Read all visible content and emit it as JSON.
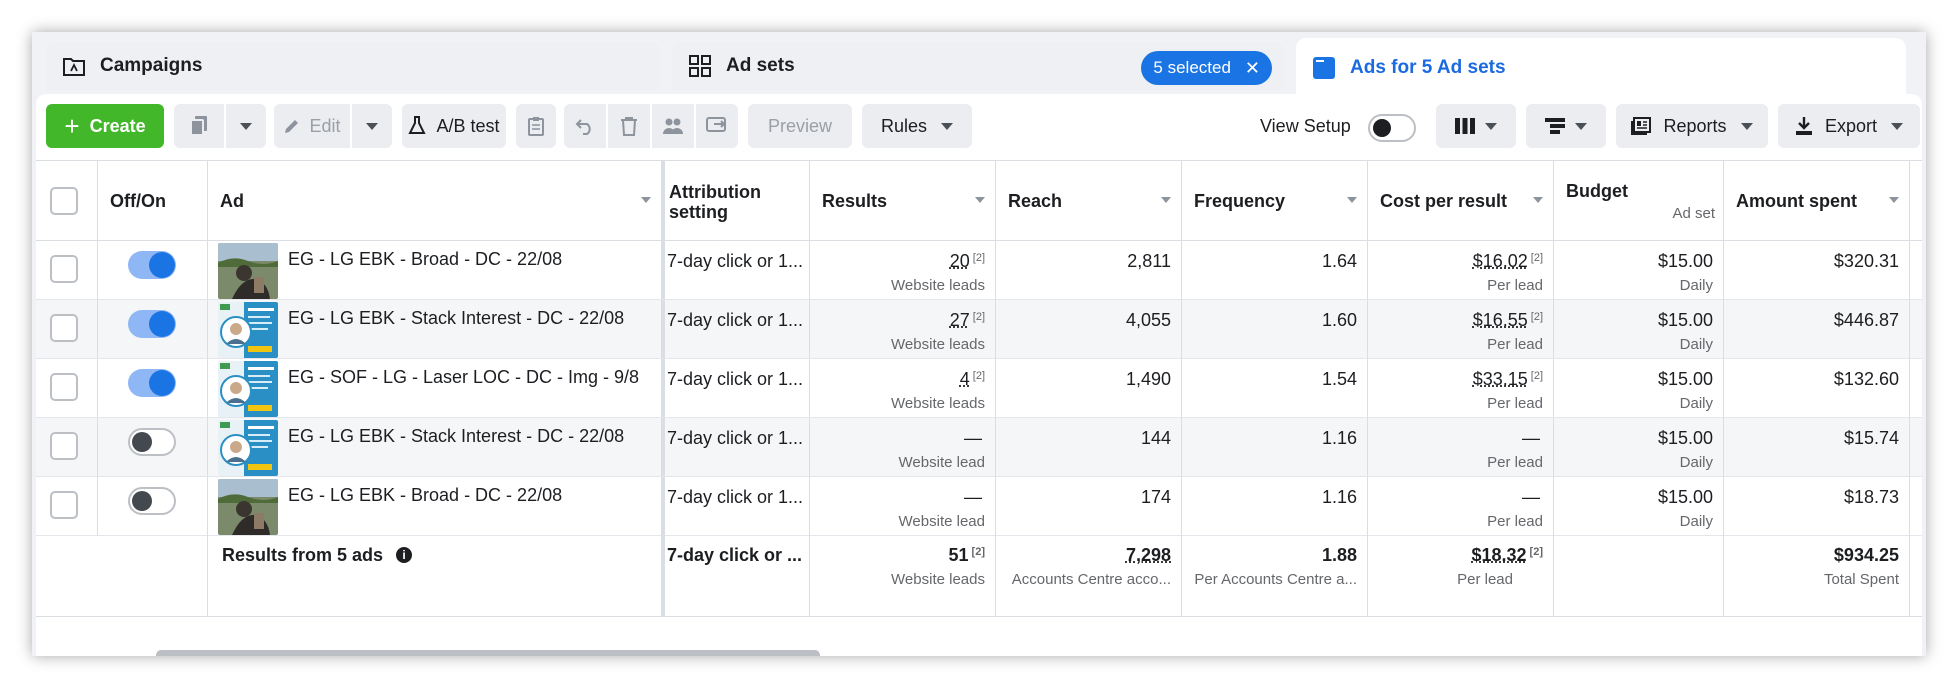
{
  "tabs": {
    "campaigns": "Campaigns",
    "adsets": "Ad sets",
    "adsets_selected": "5 selected",
    "ads": "Ads for 5 Ad sets"
  },
  "toolbar": {
    "create": "Create",
    "edit": "Edit",
    "ab_test": "A/B test",
    "preview": "Preview",
    "rules": "Rules",
    "view_setup": "View Setup",
    "reports": "Reports",
    "export": "Export"
  },
  "columns": {
    "off_on": "Off/On",
    "ad": "Ad",
    "attribution": "Attribution setting",
    "results": "Results",
    "reach": "Reach",
    "frequency": "Frequency",
    "cost_per_result": "Cost per result",
    "budget": "Budget",
    "budget_sub": "Ad set",
    "amount_spent": "Amount spent"
  },
  "rows": [
    {
      "on": true,
      "name": "EG - LG EBK - Broad - DC - 22/08",
      "thumb": "photo",
      "attribution": "7-day click or 1...",
      "results": "20",
      "results_ref": "[2]",
      "results_sub": "Website leads",
      "reach": "2,811",
      "frequency": "1.64",
      "cpr": "$16.02",
      "cpr_ref": "[2]",
      "cpr_sub": "Per lead",
      "budget": "$15.00",
      "budget_sub": "Daily",
      "spent": "$320.31"
    },
    {
      "on": true,
      "name": "EG - LG EBK - Stack Interest - DC - 22/08",
      "thumb": "flyer",
      "attribution": "7-day click or 1...",
      "results": "27",
      "results_ref": "[2]",
      "results_sub": "Website leads",
      "reach": "4,055",
      "frequency": "1.60",
      "cpr": "$16.55",
      "cpr_ref": "[2]",
      "cpr_sub": "Per lead",
      "budget": "$15.00",
      "budget_sub": "Daily",
      "spent": "$446.87"
    },
    {
      "on": true,
      "name": "EG - SOF - LG - Laser LOC - DC - Img - 9/8",
      "thumb": "flyer",
      "attribution": "7-day click or 1...",
      "results": "4",
      "results_ref": "[2]",
      "results_sub": "Website leads",
      "reach": "1,490",
      "frequency": "1.54",
      "cpr": "$33.15",
      "cpr_ref": "[2]",
      "cpr_sub": "Per lead",
      "budget": "$15.00",
      "budget_sub": "Daily",
      "spent": "$132.60"
    },
    {
      "on": false,
      "name": "EG - LG EBK - Stack Interest - DC - 22/08",
      "thumb": "flyer",
      "attribution": "7-day click or 1...",
      "results": "—",
      "results_ref": "",
      "results_sub": "Website lead",
      "reach": "144",
      "frequency": "1.16",
      "cpr": "—",
      "cpr_ref": "",
      "cpr_sub": "Per lead",
      "budget": "$15.00",
      "budget_sub": "Daily",
      "spent": "$15.74"
    },
    {
      "on": false,
      "name": "EG - LG EBK - Broad - DC - 22/08",
      "thumb": "photo",
      "attribution": "7-day click or 1...",
      "results": "—",
      "results_ref": "",
      "results_sub": "Website lead",
      "reach": "174",
      "frequency": "1.16",
      "cpr": "—",
      "cpr_ref": "",
      "cpr_sub": "Per lead",
      "budget": "$15.00",
      "budget_sub": "Daily",
      "spent": "$18.73"
    }
  ],
  "summary": {
    "label": "Results from 5 ads",
    "attribution": "7-day click or ...",
    "results": "51",
    "results_ref": "[2]",
    "results_sub": "Website leads",
    "reach": "7,298",
    "reach_sub": "Accounts Centre acco...",
    "frequency": "1.88",
    "frequency_sub": "Per Accounts Centre a...",
    "cpr": "$18.32",
    "cpr_ref": "[2]",
    "cpr_sub": "Per lead",
    "spent": "$934.25",
    "spent_sub": "Total Spent"
  },
  "colors": {
    "accent_blue": "#1b74e4",
    "create_green": "#42b72a"
  }
}
